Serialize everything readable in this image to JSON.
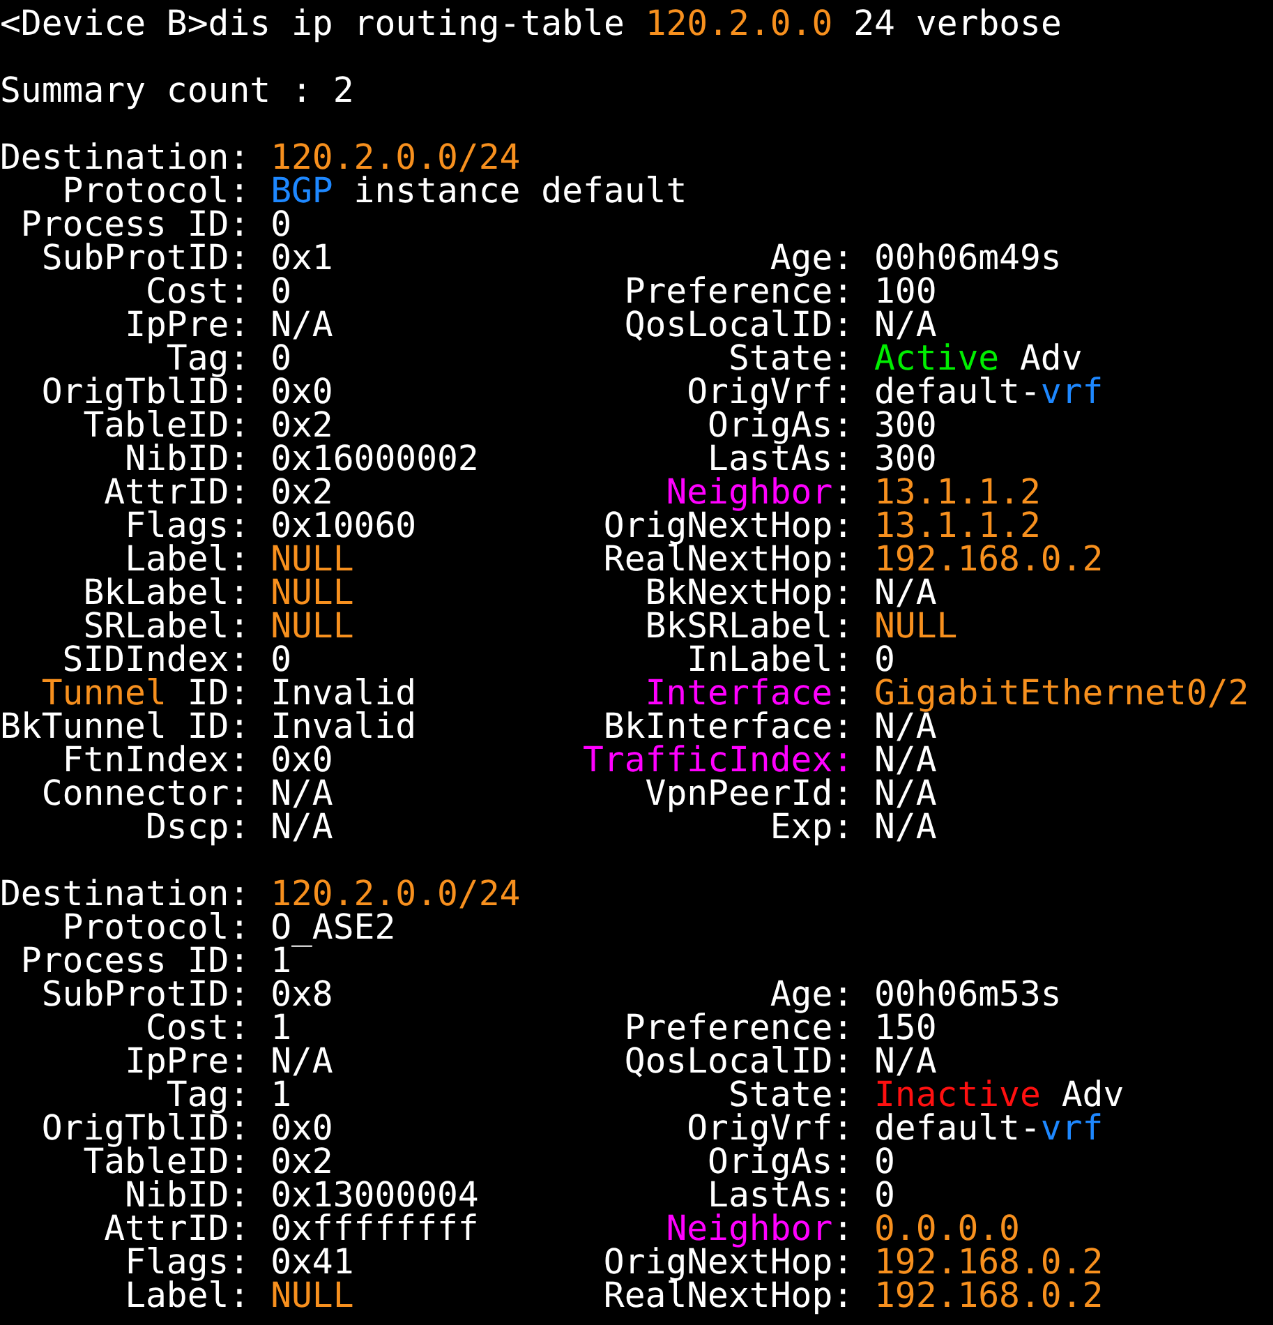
{
  "command": [
    "<Device B>dis ip routing-table ",
    {
      "text": "120.2.0.0",
      "color": "#f7901e"
    },
    " 24 verbose"
  ],
  "summary": "Summary count : 2",
  "routes": [
    {
      "rows": [
        {
          "left": {
            "label": [
              "Destination:"
            ],
            "value": [
              {
                "text": "120.2.0.0/24",
                "color": "#f7901e"
              }
            ]
          }
        },
        {
          "left": {
            "label": [
              "Protocol:"
            ],
            "value": [
              {
                "text": "BGP",
                "color": "#1e88ff"
              },
              " instance default"
            ]
          }
        },
        {
          "left": {
            "label": [
              "Process ID:"
            ],
            "value": [
              "0"
            ]
          }
        },
        {
          "left": {
            "label": [
              "SubProtID:"
            ],
            "value": [
              "0x1"
            ]
          },
          "right": {
            "label": [
              "Age:"
            ],
            "value": [
              "00h06m49s"
            ]
          }
        },
        {
          "left": {
            "label": [
              "Cost:"
            ],
            "value": [
              "0"
            ]
          },
          "right": {
            "label": [
              "Preference:"
            ],
            "value": [
              "100"
            ]
          }
        },
        {
          "left": {
            "label": [
              "IpPre:"
            ],
            "value": [
              "N/A"
            ]
          },
          "right": {
            "label": [
              "QosLocalID:"
            ],
            "value": [
              "N/A"
            ]
          }
        },
        {
          "left": {
            "label": [
              "Tag:"
            ],
            "value": [
              "0"
            ]
          },
          "right": {
            "label": [
              "State:"
            ],
            "value": [
              {
                "text": "Active",
                "color": "#00ee00"
              },
              " Adv"
            ]
          }
        },
        {
          "left": {
            "label": [
              "OrigTblID:"
            ],
            "value": [
              "0x0"
            ]
          },
          "right": {
            "label": [
              "OrigVrf:"
            ],
            "value": [
              "default-",
              {
                "text": "vrf",
                "color": "#1e88ff"
              }
            ]
          }
        },
        {
          "left": {
            "label": [
              "TableID:"
            ],
            "value": [
              "0x2"
            ]
          },
          "right": {
            "label": [
              "OrigAs:"
            ],
            "value": [
              "300"
            ]
          }
        },
        {
          "left": {
            "label": [
              "NibID:"
            ],
            "value": [
              "0x16000002"
            ]
          },
          "right": {
            "label": [
              "LastAs:"
            ],
            "value": [
              "300"
            ]
          }
        },
        {
          "left": {
            "label": [
              "AttrID:"
            ],
            "value": [
              "0x2"
            ]
          },
          "right": {
            "label": [
              {
                "text": "Neighbor",
                "color": "#ff00ff"
              },
              ":"
            ],
            "value": [
              {
                "text": "13.1.1.2",
                "color": "#f7901e"
              }
            ]
          }
        },
        {
          "left": {
            "label": [
              "Flags:"
            ],
            "value": [
              "0x10060"
            ]
          },
          "right": {
            "label": [
              "OrigNextHop:"
            ],
            "value": [
              {
                "text": "13.1.1.2",
                "color": "#f7901e"
              }
            ]
          }
        },
        {
          "left": {
            "label": [
              "Label:"
            ],
            "value": [
              {
                "text": "NULL",
                "color": "#f7901e"
              }
            ]
          },
          "right": {
            "label": [
              "RealNextHop:"
            ],
            "value": [
              {
                "text": "192.168.0.2",
                "color": "#f7901e"
              }
            ]
          }
        },
        {
          "left": {
            "label": [
              "BkLabel:"
            ],
            "value": [
              {
                "text": "NULL",
                "color": "#f7901e"
              }
            ]
          },
          "right": {
            "label": [
              "BkNextHop:"
            ],
            "value": [
              "N/A"
            ]
          }
        },
        {
          "left": {
            "label": [
              "SRLabel:"
            ],
            "value": [
              {
                "text": "NULL",
                "color": "#f7901e"
              }
            ]
          },
          "right": {
            "label": [
              "BkSRLabel:"
            ],
            "value": [
              {
                "text": "NULL",
                "color": "#f7901e"
              }
            ]
          }
        },
        {
          "left": {
            "label": [
              "SIDIndex:"
            ],
            "value": [
              "0"
            ]
          },
          "right": {
            "label": [
              "InLabel:"
            ],
            "value": [
              "0"
            ]
          }
        },
        {
          "left": {
            "label": [
              {
                "text": "Tunnel",
                "color": "#f7901e"
              },
              " ID:"
            ],
            "value": [
              "Invalid"
            ]
          },
          "right": {
            "label": [
              {
                "text": "Interface",
                "color": "#ff00ff"
              },
              ":"
            ],
            "value": [
              {
                "text": "GigabitEthernet0/2",
                "color": "#f7901e"
              }
            ]
          }
        },
        {
          "left": {
            "label": [
              "BkTunnel ID:"
            ],
            "value": [
              "Invalid"
            ]
          },
          "right": {
            "label": [
              "BkInterface:"
            ],
            "value": [
              "N/A"
            ]
          }
        },
        {
          "left": {
            "label": [
              "FtnIndex:"
            ],
            "value": [
              "0x0"
            ]
          },
          "right": {
            "label": [
              {
                "text": "TrafficIndex:",
                "color": "#ff00ff"
              }
            ],
            "value": [
              "N/A"
            ]
          }
        },
        {
          "left": {
            "label": [
              "Connector:"
            ],
            "value": [
              "N/A"
            ]
          },
          "right": {
            "label": [
              "VpnPeerId:"
            ],
            "value": [
              "N/A"
            ]
          }
        },
        {
          "left": {
            "label": [
              "Dscp:"
            ],
            "value": [
              "N/A"
            ]
          },
          "right": {
            "label": [
              "Exp:"
            ],
            "value": [
              "N/A"
            ]
          }
        }
      ]
    },
    {
      "rows": [
        {
          "left": {
            "label": [
              "Destination:"
            ],
            "value": [
              {
                "text": "120.2.0.0/24",
                "color": "#f7901e"
              }
            ]
          }
        },
        {
          "left": {
            "label": [
              "Protocol:"
            ],
            "value": [
              "O_ASE2"
            ]
          }
        },
        {
          "left": {
            "label": [
              "Process ID:"
            ],
            "value": [
              "1"
            ]
          }
        },
        {
          "left": {
            "label": [
              "SubProtID:"
            ],
            "value": [
              "0x8"
            ]
          },
          "right": {
            "label": [
              "Age:"
            ],
            "value": [
              "00h06m53s"
            ]
          }
        },
        {
          "left": {
            "label": [
              "Cost:"
            ],
            "value": [
              "1"
            ]
          },
          "right": {
            "label": [
              "Preference:"
            ],
            "value": [
              "150"
            ]
          }
        },
        {
          "left": {
            "label": [
              "IpPre:"
            ],
            "value": [
              "N/A"
            ]
          },
          "right": {
            "label": [
              "QosLocalID:"
            ],
            "value": [
              "N/A"
            ]
          }
        },
        {
          "left": {
            "label": [
              "Tag:"
            ],
            "value": [
              "1"
            ]
          },
          "right": {
            "label": [
              "State:"
            ],
            "value": [
              {
                "text": "Inactive",
                "color": "#ff1010"
              },
              " Adv"
            ]
          }
        },
        {
          "left": {
            "label": [
              "OrigTblID:"
            ],
            "value": [
              "0x0"
            ]
          },
          "right": {
            "label": [
              "OrigVrf:"
            ],
            "value": [
              "default-",
              {
                "text": "vrf",
                "color": "#1e88ff"
              }
            ]
          }
        },
        {
          "left": {
            "label": [
              "TableID:"
            ],
            "value": [
              "0x2"
            ]
          },
          "right": {
            "label": [
              "OrigAs:"
            ],
            "value": [
              "0"
            ]
          }
        },
        {
          "left": {
            "label": [
              "NibID:"
            ],
            "value": [
              "0x13000004"
            ]
          },
          "right": {
            "label": [
              "LastAs:"
            ],
            "value": [
              "0"
            ]
          }
        },
        {
          "left": {
            "label": [
              "AttrID:"
            ],
            "value": [
              "0xffffffff"
            ]
          },
          "right": {
            "label": [
              {
                "text": "Neighbor",
                "color": "#ff00ff"
              },
              ":"
            ],
            "value": [
              {
                "text": "0.0.0.0",
                "color": "#f7901e"
              }
            ]
          }
        },
        {
          "left": {
            "label": [
              "Flags:"
            ],
            "value": [
              "0x41"
            ]
          },
          "right": {
            "label": [
              "OrigNextHop:"
            ],
            "value": [
              {
                "text": "192.168.0.2",
                "color": "#f7901e"
              }
            ]
          }
        },
        {
          "left": {
            "label": [
              "Label:"
            ],
            "value": [
              {
                "text": "NULL",
                "color": "#f7901e"
              }
            ]
          },
          "right": {
            "label": [
              "RealNextHop:"
            ],
            "value": [
              {
                "text": "192.168.0.2",
                "color": "#f7901e"
              }
            ]
          }
        }
      ]
    }
  ]
}
